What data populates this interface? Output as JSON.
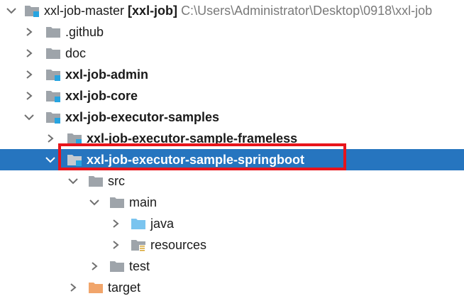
{
  "root": {
    "name": "xxl-job-master",
    "module": "[xxl-job]",
    "path": "C:\\Users\\Administrator\\Desktop\\0918\\xxl-job"
  },
  "items": [
    {
      "label": ".github"
    },
    {
      "label": "doc"
    },
    {
      "label": "xxl-job-admin"
    },
    {
      "label": "xxl-job-core"
    },
    {
      "label": "xxl-job-executor-samples"
    },
    {
      "label": "xxl-job-executor-sample-frameless"
    },
    {
      "label": "xxl-job-executor-sample-springboot"
    },
    {
      "label": "src"
    },
    {
      "label": "main"
    },
    {
      "label": "java"
    },
    {
      "label": "resources"
    },
    {
      "label": "test"
    },
    {
      "label": "target"
    }
  ],
  "colors": {
    "selection": "#2675bf",
    "folder_gray": "#9ea4aa",
    "module_badge": "#27a4e0",
    "source_folder": "#7ac4ef",
    "excluded_folder": "#f1a56b",
    "highlight_border": "#e8141b"
  }
}
